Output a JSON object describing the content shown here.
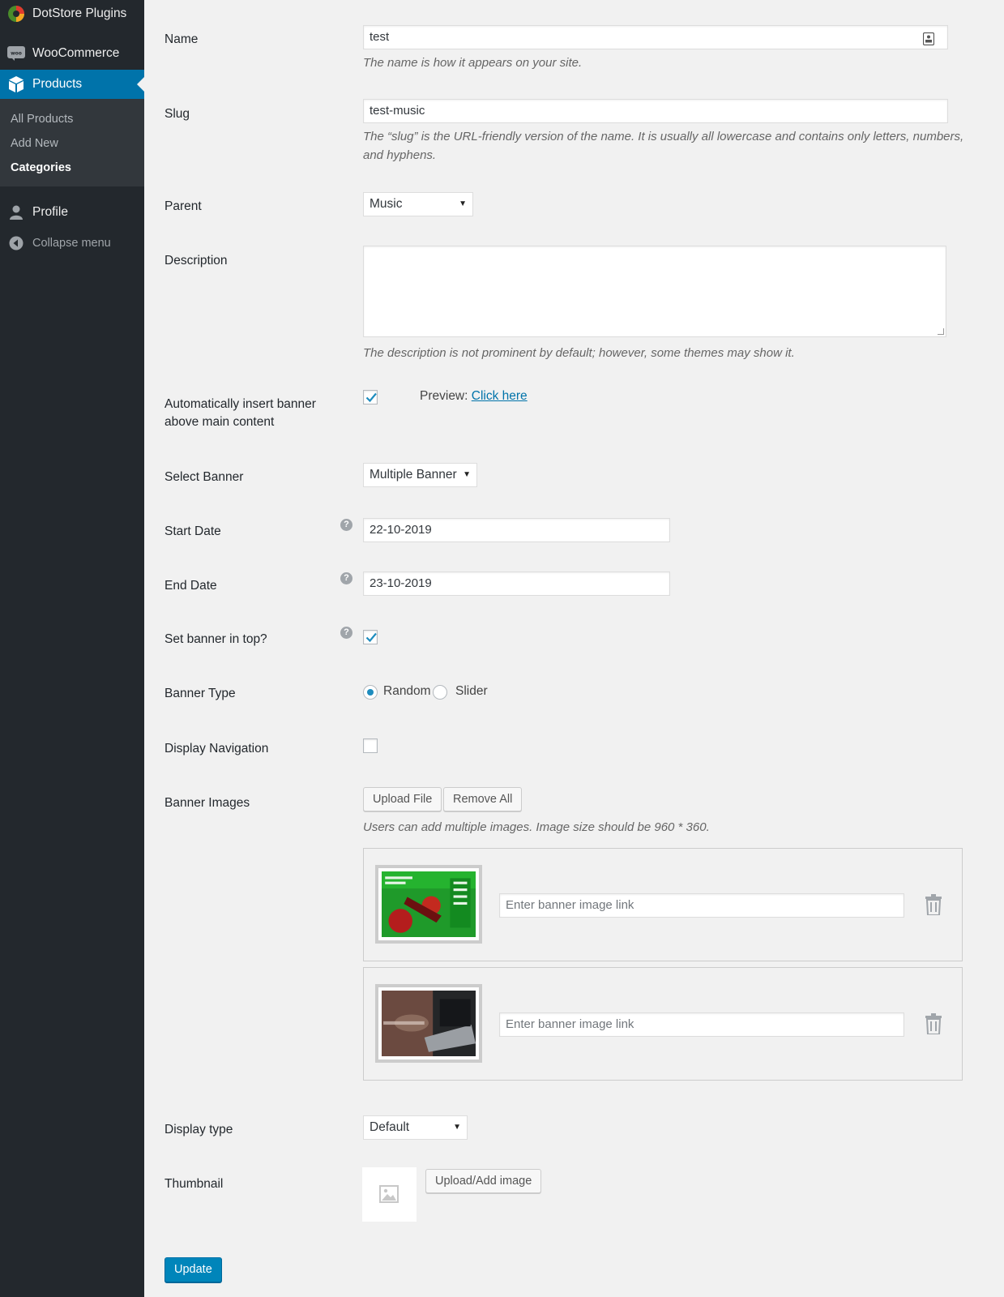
{
  "sidebar": {
    "dotstore": "DotStore Plugins",
    "woocommerce": "WooCommerce",
    "products": "Products",
    "submenu": [
      "All Products",
      "Add New",
      "Categories"
    ],
    "profile": "Profile",
    "collapse": "Collapse menu"
  },
  "form": {
    "name": {
      "label": "Name",
      "value": "test",
      "help": "The name is how it appears on your site."
    },
    "slug": {
      "label": "Slug",
      "value": "test-music",
      "help_1": "The “slug” is the URL-friendly version of the name. It is usually all lowercase and contains only letters, numbers,",
      "help_2": "and hyphens."
    },
    "parent": {
      "label": "Parent",
      "value": "Music"
    },
    "description": {
      "label": "Description",
      "help": "The description is not prominent by default; however, some themes may show it."
    },
    "auto_banner": {
      "label_1": "Automatically insert banner",
      "label_2": "above main content",
      "checked": true,
      "preview_label": "Preview:",
      "preview_link": "Click here"
    },
    "select_banner": {
      "label": "Select Banner",
      "value": "Multiple Banner"
    },
    "start_date": {
      "label": "Start Date",
      "value": "22-10-2019"
    },
    "end_date": {
      "label": "End Date",
      "value": "23-10-2019"
    },
    "banner_top": {
      "label": "Set banner in top?",
      "checked": true
    },
    "banner_type": {
      "label": "Banner Type",
      "options": [
        "Random",
        "Slider"
      ],
      "selected": "Random"
    },
    "display_nav": {
      "label": "Display Navigation",
      "checked": false
    },
    "banner_images": {
      "label": "Banner Images",
      "upload_btn": "Upload File",
      "remove_btn": "Remove All",
      "help": "Users can add multiple images. Image size should be 960 * 360.",
      "items": [
        {
          "link_placeholder": "Enter banner image link"
        },
        {
          "link_placeholder": "Enter banner image link"
        }
      ]
    },
    "display_type": {
      "label": "Display type",
      "value": "Default"
    },
    "thumbnail": {
      "label": "Thumbnail",
      "button": "Upload/Add image"
    },
    "update_btn": "Update"
  },
  "help_icon": "?",
  "colors": {
    "accent": "#0073aa",
    "sidebar": "#23282d",
    "submenu": "#32373c"
  }
}
